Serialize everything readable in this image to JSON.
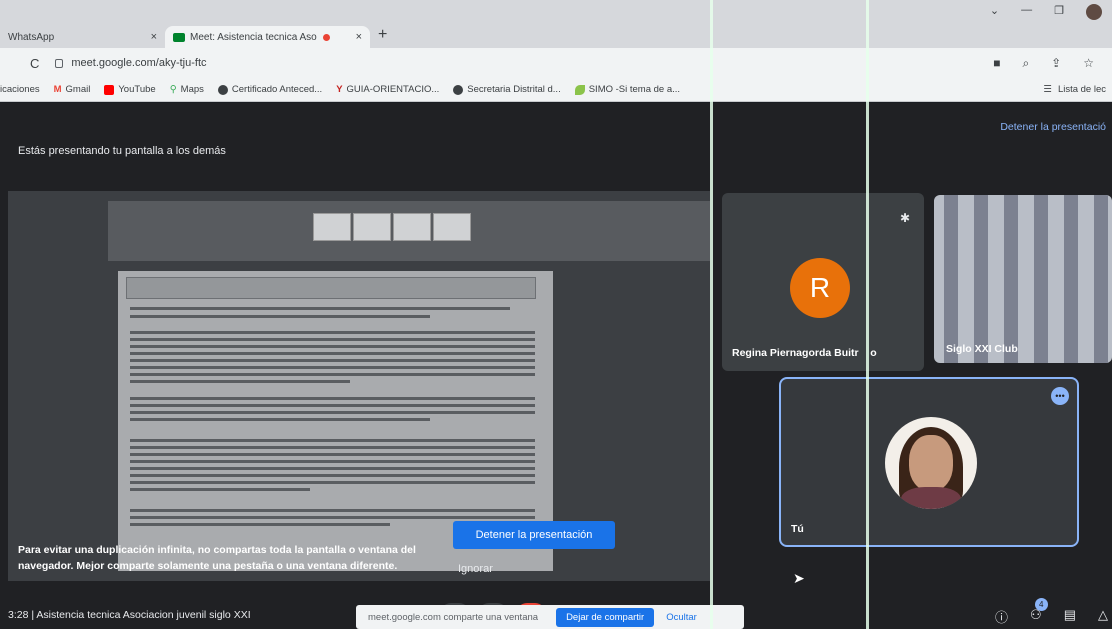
{
  "browser": {
    "tabs": [
      {
        "label": "WhatsApp",
        "close": "×"
      },
      {
        "label": "Meet: Asistencia tecnica Aso",
        "close": "×"
      }
    ],
    "new_tab": "+",
    "url": "meet.google.com/aky-tju-ftc",
    "bookmarks": [
      {
        "label": "icaciones",
        "icon": "apps-icon"
      },
      {
        "label": "Gmail",
        "icon": "gmail-icon",
        "color": "#ea4335"
      },
      {
        "label": "YouTube",
        "icon": "youtube-icon",
        "color": "#ff0000"
      },
      {
        "label": "Maps",
        "icon": "maps-icon",
        "color": "#34a853"
      },
      {
        "label": "Certificado Anteced...",
        "icon": "globe-icon"
      },
      {
        "label": "GUIA-ORIENTACIO...",
        "icon": "bookmark-icon"
      },
      {
        "label": "Secretaria Distrital d...",
        "icon": "globe-icon"
      },
      {
        "label": "SIMO -Si tema de a...",
        "icon": "leaf-icon"
      }
    ],
    "reading_list": "Lista de lec"
  },
  "meet": {
    "presenting_notice": "Estás presentando tu pantalla a los demás",
    "stop_presenting_link": "Detener la presentació",
    "duplication_warning_line1": "Para evitar una duplicación infinita, no compartas toda la pantalla o ventana del",
    "duplication_warning_line2": "navegador. Mejor comparte solamente una pestaña o una ventana diferente.",
    "stop_presenting_button": "Detener la presentación",
    "ignore_button": "Ignorar",
    "participants": {
      "regina": {
        "initial": "R",
        "name": "Regina Piernagorda Buitr",
        "suffix": "o"
      },
      "club": {
        "name": "Siglo XXI Club"
      },
      "you": {
        "label": "Tú",
        "more": "•••"
      }
    },
    "meeting_info": "3:28  |  Asistencia tecnica Asociacion juvenil siglo XXI",
    "share_notice": {
      "text": "meet.google.com comparte una ventana",
      "stop": "Dejar de compartir",
      "hide": "Ocultar"
    },
    "people_count": "4"
  },
  "colors": {
    "accent": "#1a73e8",
    "regina_avatar": "#e8710a",
    "link": "#8ab4f8"
  }
}
